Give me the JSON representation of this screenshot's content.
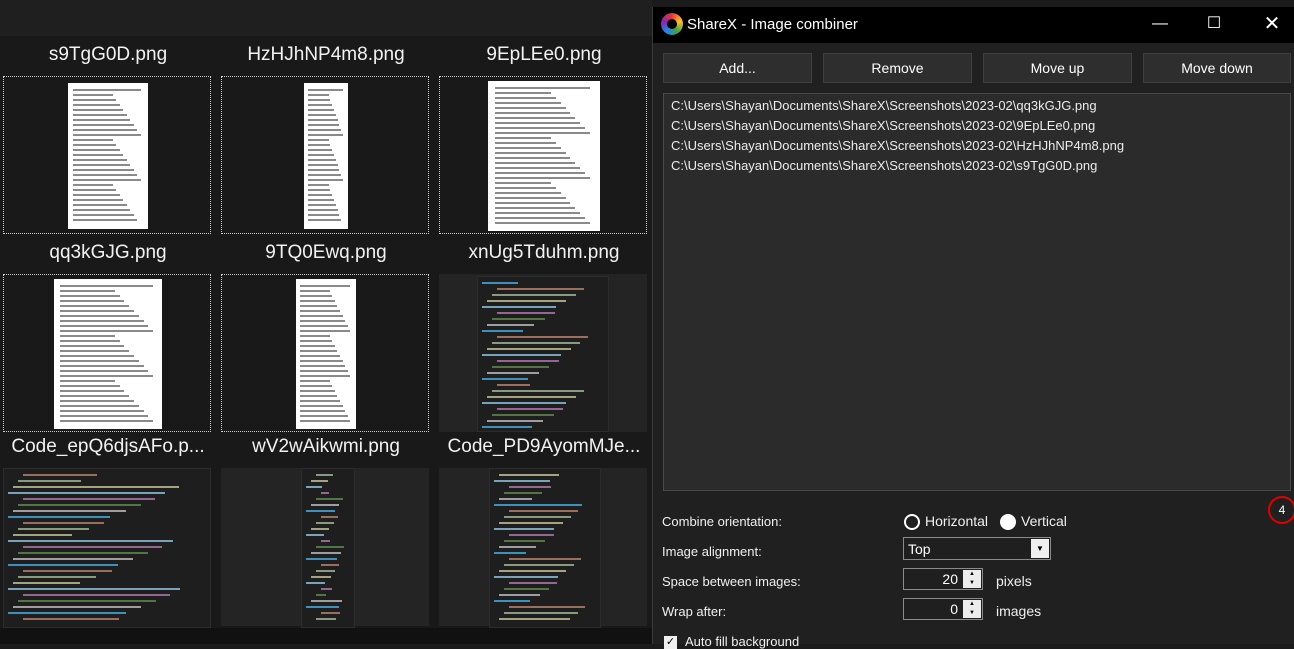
{
  "gallery": {
    "tiles": [
      {
        "name": "s9TgG0D.png",
        "kind": "paper"
      },
      {
        "name": "HzHJhNP4m8.png",
        "kind": "paper"
      },
      {
        "name": "9EpLEe0.png",
        "kind": "paper"
      },
      {
        "name": "qq3kGJG.png",
        "kind": "paper"
      },
      {
        "name": "9TQ0Ewq.png",
        "kind": "paper"
      },
      {
        "name": "xnUg5Tduhm.png",
        "kind": "dark"
      },
      {
        "name": "Code_epQ6djsAFo.p...",
        "kind": "dark"
      },
      {
        "name": "wV2wAikwmi.png",
        "kind": "dark"
      },
      {
        "name": "Code_PD9AyomMJe...",
        "kind": "dark"
      }
    ]
  },
  "dialog": {
    "title": "ShareX - Image combiner",
    "buttons": {
      "add": "Add...",
      "remove": "Remove",
      "move_up": "Move up",
      "move_down": "Move down"
    },
    "files": [
      "C:\\Users\\Shayan\\Documents\\ShareX\\Screenshots\\2023-02\\qq3kGJG.png",
      "C:\\Users\\Shayan\\Documents\\ShareX\\Screenshots\\2023-02\\9EpLEe0.png",
      "C:\\Users\\Shayan\\Documents\\ShareX\\Screenshots\\2023-02\\HzHJhNP4m8.png",
      "C:\\Users\\Shayan\\Documents\\ShareX\\Screenshots\\2023-02\\s9TgG0D.png"
    ],
    "file_count": "4",
    "combine_orientation": {
      "label": "Combine orientation:",
      "options": [
        "Horizontal",
        "Vertical"
      ],
      "selected": "Vertical"
    },
    "image_alignment": {
      "label": "Image alignment:",
      "value": "Top"
    },
    "space_between": {
      "label": "Space between images:",
      "value": "20",
      "unit": "pixels"
    },
    "wrap_after": {
      "label": "Wrap after:",
      "value": "0",
      "unit": "images"
    },
    "auto_fill": {
      "label": "Auto fill background",
      "checked": true
    }
  }
}
